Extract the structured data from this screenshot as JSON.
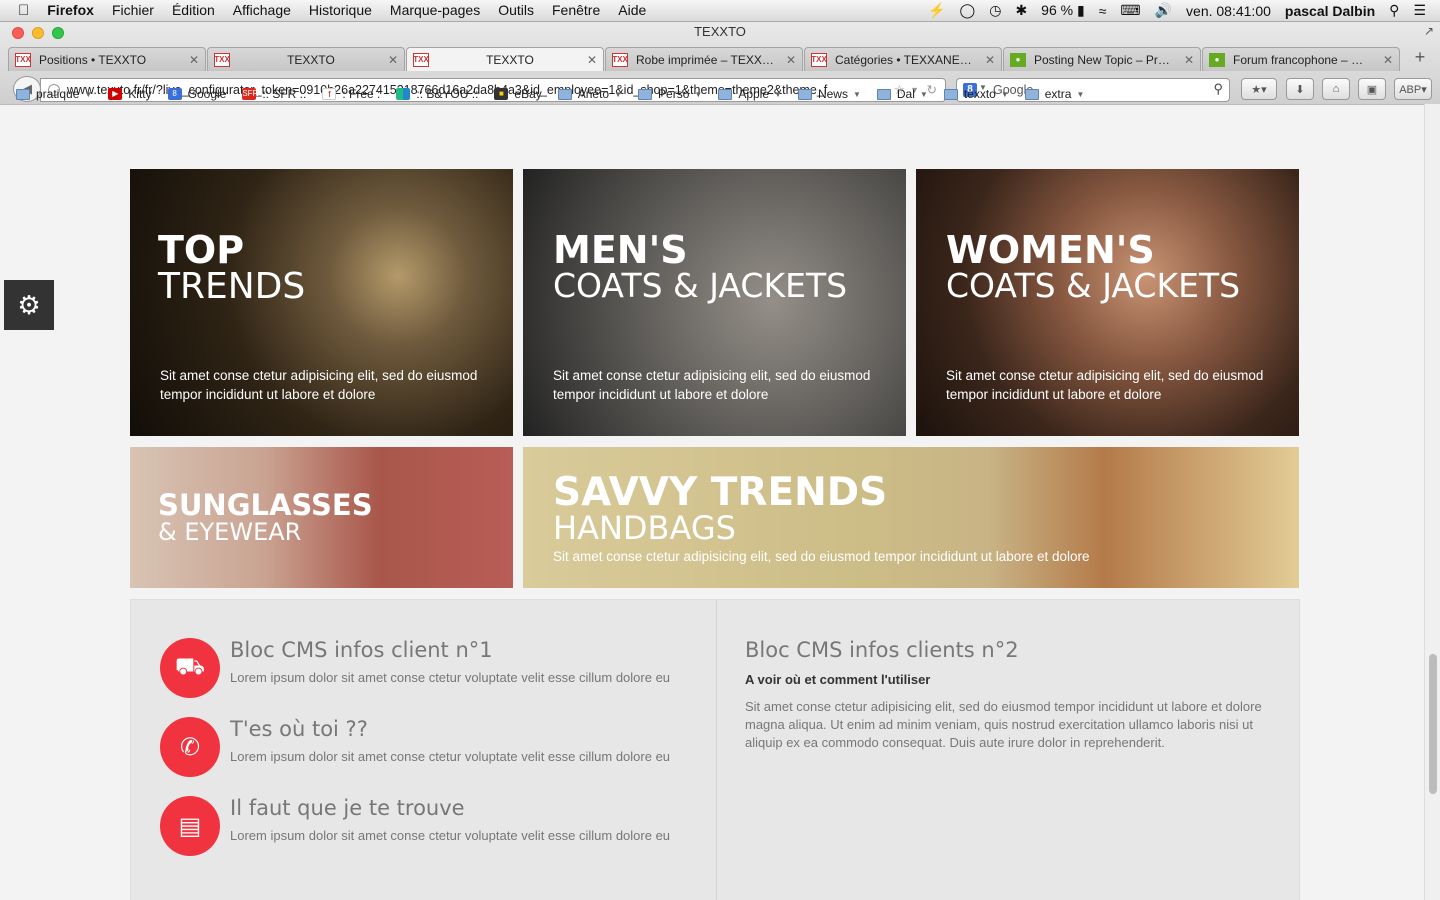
{
  "menubar": {
    "apple": "",
    "app": "Firefox",
    "items": [
      "Fichier",
      "Édition",
      "Affichage",
      "Historique",
      "Marque-pages",
      "Outils",
      "Fenêtre",
      "Aide"
    ],
    "battery": "96 %",
    "clock": "ven. 08:41:00",
    "user": "pascal Dalbin"
  },
  "window": {
    "title": "TEXXTO"
  },
  "tabs": [
    {
      "label": "Positions • TEXXTO"
    },
    {
      "label": "TEXXTO"
    },
    {
      "label": "TEXXTO"
    },
    {
      "label": "Robe imprimée – TEXX…"
    },
    {
      "label": "Catégories • TEXXANE…"
    },
    {
      "label": "Posting New Topic – Pr…"
    },
    {
      "label": "Forum francophone – …"
    }
  ],
  "nav": {
    "url": "www.texxto.fr/fr/?live_configurator_token=0910b26a227415218766d16a2da8b4a3&id_employee=1&id_shop=1&theme=theme2&theme_f",
    "search_placeholder": "Google"
  },
  "bookmarks": [
    {
      "label": "pratique",
      "icon": "folder-icon",
      "menu": true
    },
    {
      "label": "Kitty",
      "icon": "youtube-icon",
      "menu": false
    },
    {
      "label": "Google",
      "icon": "google-icon",
      "menu": false
    },
    {
      "label": ":: SFR ::",
      "icon": "sfr-icon",
      "menu": false
    },
    {
      "label": ": Free :",
      "icon": "free-icon",
      "menu": false
    },
    {
      "label": ":: B&YOU ::",
      "icon": "byou-icon",
      "menu": false
    },
    {
      "label": "eBay",
      "icon": "ebay-icon",
      "menu": false
    },
    {
      "label": "Aneto",
      "icon": "folder-icon",
      "menu": true
    },
    {
      "label": "Perso",
      "icon": "folder-icon",
      "menu": true
    },
    {
      "label": "Apple",
      "icon": "folder-icon",
      "menu": true
    },
    {
      "label": "News",
      "icon": "folder-icon",
      "menu": true
    },
    {
      "label": "Dal",
      "icon": "folder-icon",
      "menu": true
    },
    {
      "label": "texxto",
      "icon": "folder-icon",
      "menu": true
    },
    {
      "label": "extra",
      "icon": "folder-icon",
      "menu": true
    }
  ],
  "banners": {
    "top_trends": {
      "line1": "TOP",
      "line2": "TRENDS",
      "text": "Sit amet conse ctetur adipisicing elit, sed do eiusmod tempor incididunt ut labore et dolore"
    },
    "mens": {
      "line1": "MEN'S",
      "line2": "COATS & JACKETS",
      "text": "Sit amet conse ctetur adipisicing elit, sed do eiusmod tempor incididunt ut labore et dolore"
    },
    "womens": {
      "line1": "WOMEN'S",
      "line2": "COATS & JACKETS",
      "text": "Sit amet conse ctetur adipisicing elit, sed do eiusmod tempor incididunt ut labore et dolore"
    },
    "sunglasses": {
      "line1": "SUNGLASSES",
      "line2": "& EYEWEAR"
    },
    "handbags": {
      "line1": "SAVVY TRENDS",
      "line2": "HANDBAGS",
      "text": "Sit amet conse ctetur adipisicing elit, sed do eiusmod tempor incididunt ut labore et dolore"
    }
  },
  "cms1": {
    "items": [
      {
        "title": "Bloc CMS infos client n°1",
        "text": "Lorem ipsum dolor sit amet conse ctetur voluptate velit esse cillum dolore eu",
        "icon": "truck-icon"
      },
      {
        "title": "T'es où toi ??",
        "text": "Lorem ipsum dolor sit amet conse ctetur voluptate velit esse cillum dolore eu",
        "icon": "phone-icon"
      },
      {
        "title": "Il faut que je te trouve",
        "text": "Lorem ipsum dolor sit amet conse ctetur voluptate velit esse cillum dolore eu",
        "icon": "credit-card-icon"
      }
    ]
  },
  "cms2": {
    "title": "Bloc CMS infos clients n°2",
    "subtitle": "A voir où et comment l'utiliser",
    "text": "Sit amet conse ctetur adipisicing elit, sed do eiusmod tempor incididunt ut labore et dolore magna aliqua. Ut enim ad minim veniam, quis nostrud exercitation ullamco laboris nisi ut aliquip ex ea commodo consequat. Duis aute irure dolor in reprehenderit."
  },
  "colors": {
    "accent": "#f13340",
    "cms_bg": "#e7e7e7"
  }
}
